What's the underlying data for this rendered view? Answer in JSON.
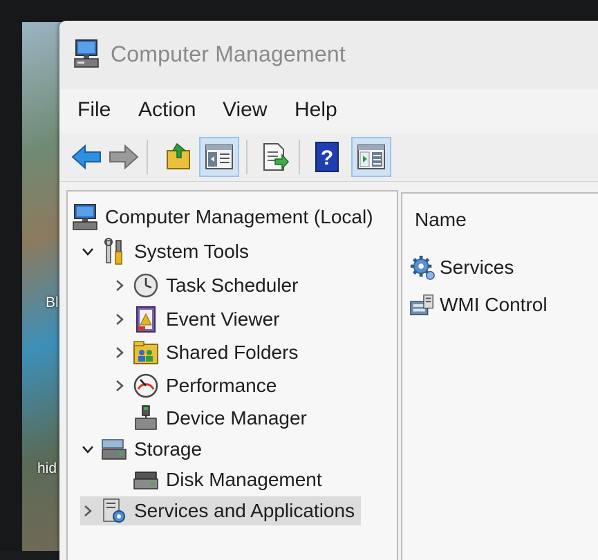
{
  "window": {
    "title": "Computer Management"
  },
  "desktop": {
    "label_1": "Bl",
    "label_2": "hid"
  },
  "menu": {
    "file": "File",
    "action": "Action",
    "view": "View",
    "help": "Help"
  },
  "toolbar": {
    "icons": [
      "back-arrow-icon",
      "forward-arrow-icon",
      "up-folder-icon",
      "show-hide-console-tree-icon",
      "export-list-icon",
      "help-icon",
      "show-hide-action-pane-icon"
    ]
  },
  "tree": {
    "root": "Computer Management (Local)",
    "system_tools": "System Tools",
    "task_scheduler": "Task Scheduler",
    "event_viewer": "Event Viewer",
    "shared_folders": "Shared Folders",
    "performance": "Performance",
    "device_manager": "Device Manager",
    "storage": "Storage",
    "disk_management": "Disk Management",
    "services_apps": "Services and Applications"
  },
  "list": {
    "column_name": "Name",
    "items": [
      "Services",
      "WMI Control"
    ]
  },
  "colors": {
    "selection": "#dcdcdc",
    "toolbar_active": "#cfe3f5",
    "arrow_blue": "#2f8fe0"
  }
}
